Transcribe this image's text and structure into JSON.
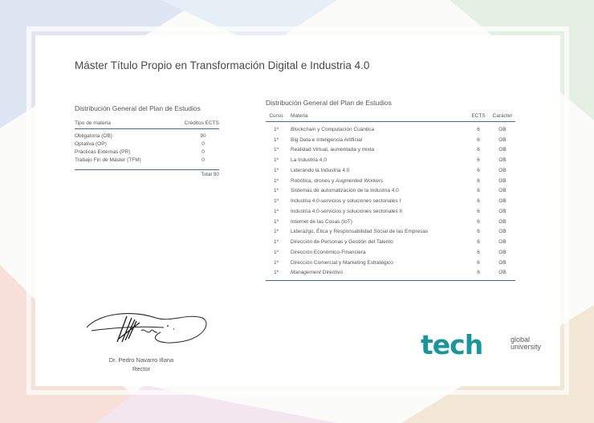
{
  "title": "Máster Título Propio en Transformación Digital e Industria 4.0",
  "summary": {
    "heading": "Distribución General del Plan de Estudios",
    "col_type": "Tipo de materia",
    "col_credits": "Créditos ECTS",
    "rows": [
      {
        "type": "Obligatoria (OB)",
        "credits": "90"
      },
      {
        "type": "Optativa (OP)",
        "credits": "0"
      },
      {
        "type": "Prácticas Externas (PR)",
        "credits": "0"
      },
      {
        "type": "Trabajo Fin de Máster (TFM)",
        "credits": "0"
      }
    ],
    "total": "Total 90"
  },
  "subjects": {
    "heading": "Distribución General del Plan de Estudios",
    "col_curso": "Curso",
    "col_materia": "Materia",
    "col_ects": "ECTS",
    "col_caracter": "Carácter",
    "rows": [
      {
        "curso": "1º",
        "m1": "Blockchain",
        "m2": " y Computación Cuántica",
        "ects": "6",
        "car": "OB"
      },
      {
        "curso": "1º",
        "m1": "",
        "m2": "Big Data e Inteligencia Artificial",
        "ects": "6",
        "car": "OB"
      },
      {
        "curso": "1º",
        "m1": "",
        "m2": "Realidad Virtual, aumentada y mixta",
        "ects": "6",
        "car": "OB"
      },
      {
        "curso": "1º",
        "m1": "",
        "m2": "La Industria 4.0",
        "ects": "6",
        "car": "OB"
      },
      {
        "curso": "1º",
        "m1": "",
        "m2": "Liderando la Industria 4.0",
        "ects": "6",
        "car": "OB"
      },
      {
        "curso": "1º",
        "m1": "",
        "m2": "Robótica, drones y ",
        "m3": "Augmented Workers",
        "ects": "6",
        "car": "OB"
      },
      {
        "curso": "1º",
        "m1": "",
        "m2": "Sistemas de automatización de la Industria 4.0",
        "ects": "6",
        "car": "OB"
      },
      {
        "curso": "1º",
        "m1": "",
        "m2": "Industria 4.0-servicios y soluciones sectoriales I",
        "ects": "6",
        "car": "OB"
      },
      {
        "curso": "1º",
        "m1": "",
        "m2": "Industria 4.0-servicios y soluciones sectoriales II",
        "ects": "6",
        "car": "OB"
      },
      {
        "curso": "1º",
        "m1": "",
        "m2": "Internet de las Cosas (IoT)",
        "ects": "6",
        "car": "OB"
      },
      {
        "curso": "1º",
        "m1": "",
        "m2": "Liderazgo, Ética y Responsabilidad Social de las Empresas",
        "ects": "6",
        "car": "OB"
      },
      {
        "curso": "1º",
        "m1": "",
        "m2": "Dirección de Personas y Gestión del Talento",
        "ects": "6",
        "car": "OB"
      },
      {
        "curso": "1º",
        "m1": "",
        "m2": "Dirección Económico-Financiera",
        "ects": "6",
        "car": "OB"
      },
      {
        "curso": "1º",
        "m1": "",
        "m2": "Dirección Comercial y Marketing Estratégico",
        "ects": "6",
        "car": "OB"
      },
      {
        "curso": "1º",
        "m1": "Management",
        "m2": " Directivo",
        "ects": "6",
        "car": "OB"
      }
    ]
  },
  "rector": {
    "name": "Dr. Pedro Navarro Illana",
    "title": "Rector"
  },
  "logo": {
    "word": "tech",
    "line1": "global",
    "line2": "university",
    "color": "#17979c"
  }
}
